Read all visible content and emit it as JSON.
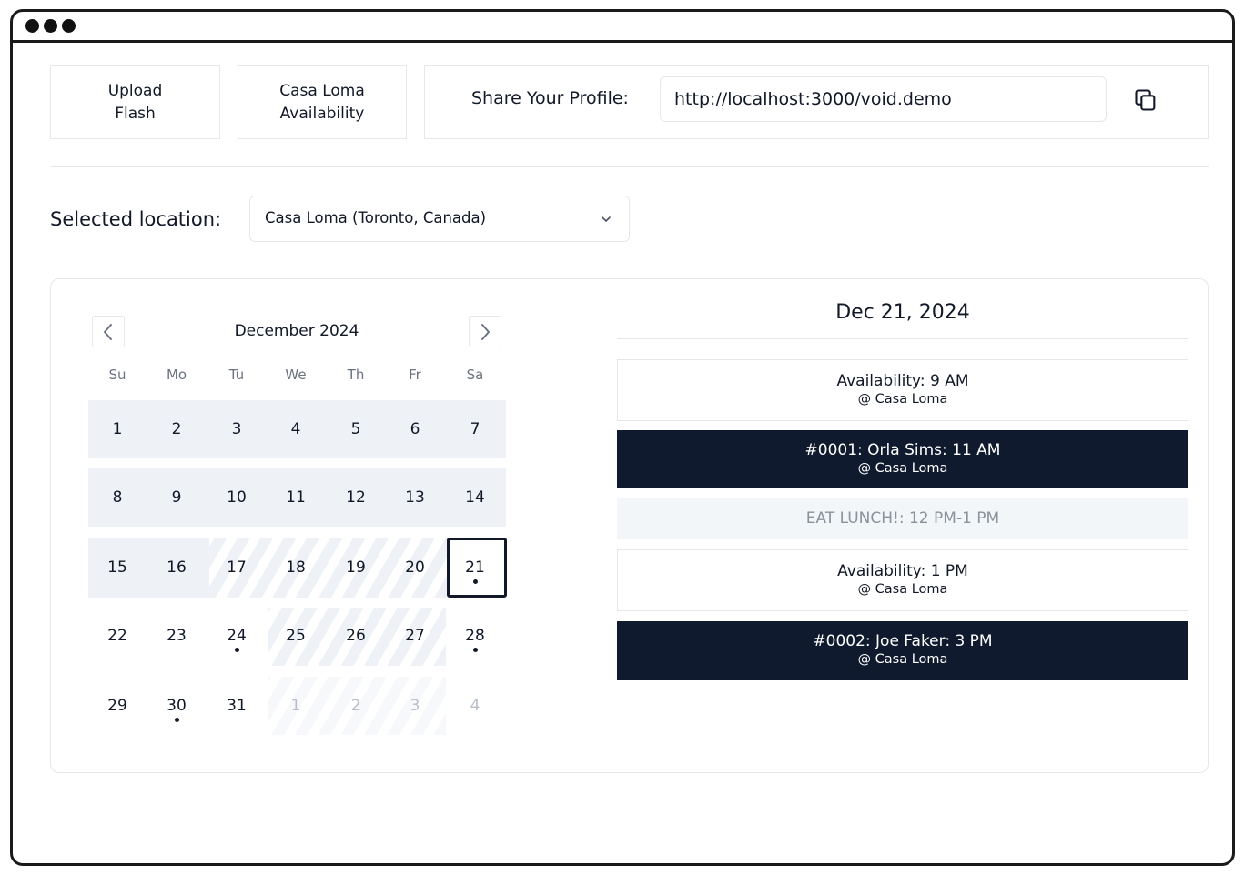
{
  "toolbar": {
    "upload_label": "Upload\nFlash",
    "availability_label": "Casa Loma\nAvailability",
    "share_label": "Share Your Profile:",
    "share_url": "http://localhost:3000/void.demo"
  },
  "location": {
    "label": "Selected location:",
    "value": "Casa Loma (Toronto, Canada)"
  },
  "calendar": {
    "month_label": "December 2024",
    "weekdays": [
      "Su",
      "Mo",
      "Tu",
      "We",
      "Th",
      "Fr",
      "Sa"
    ],
    "weeks": [
      [
        {
          "d": "1"
        },
        {
          "d": "2"
        },
        {
          "d": "3"
        },
        {
          "d": "4"
        },
        {
          "d": "5"
        },
        {
          "d": "6"
        },
        {
          "d": "7"
        }
      ],
      [
        {
          "d": "8"
        },
        {
          "d": "9"
        },
        {
          "d": "10"
        },
        {
          "d": "11"
        },
        {
          "d": "12"
        },
        {
          "d": "13"
        },
        {
          "d": "14"
        }
      ],
      [
        {
          "d": "15"
        },
        {
          "d": "16"
        },
        {
          "d": "17"
        },
        {
          "d": "18"
        },
        {
          "d": "19"
        },
        {
          "d": "20"
        },
        {
          "d": "21",
          "dot": true,
          "selected": true
        }
      ],
      [
        {
          "d": "22"
        },
        {
          "d": "23"
        },
        {
          "d": "24",
          "dot": true
        },
        {
          "d": "25"
        },
        {
          "d": "26"
        },
        {
          "d": "27"
        },
        {
          "d": "28",
          "dot": true
        }
      ],
      [
        {
          "d": "29"
        },
        {
          "d": "30",
          "dot": true
        },
        {
          "d": "31"
        },
        {
          "d": "1",
          "muted": true
        },
        {
          "d": "2",
          "muted": true
        },
        {
          "d": "3",
          "muted": true
        },
        {
          "d": "4",
          "muted": true
        }
      ]
    ],
    "selected_day": "21"
  },
  "schedule": {
    "date_heading": "Dec 21, 2024",
    "slots": [
      {
        "title": "Availability: 9 AM",
        "sub": "@ Casa Loma",
        "kind": "open"
      },
      {
        "title": "#0001: Orla Sims: 11 AM",
        "sub": "@ Casa Loma",
        "kind": "booked"
      },
      {
        "title": "EAT LUNCH!: 12 PM-1 PM",
        "sub": "",
        "kind": "break"
      },
      {
        "title": "Availability: 1 PM",
        "sub": "@ Casa Loma",
        "kind": "open"
      },
      {
        "title": "#0002: Joe Faker: 3 PM",
        "sub": "@ Casa Loma",
        "kind": "booked"
      }
    ]
  },
  "colors": {
    "booked_bg": "#0f1a2e",
    "week_bg": "#eef2f7",
    "border": "#e5e7eb"
  },
  "icons": {
    "copy": "copy-icon",
    "prev": "chevron-left-icon",
    "next": "chevron-right-icon",
    "dropdown": "chevron-down-icon"
  }
}
